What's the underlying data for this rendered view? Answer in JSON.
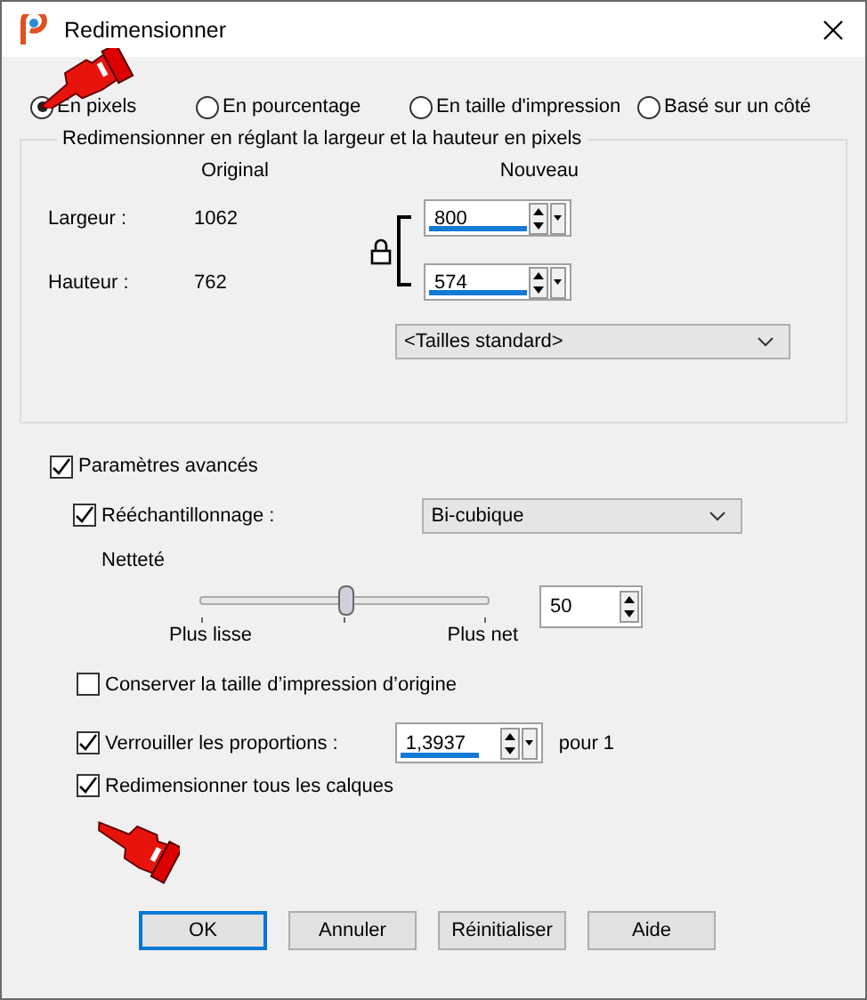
{
  "window": {
    "title": "Redimensionner"
  },
  "modes": [
    {
      "label": "En pixels",
      "selected": true
    },
    {
      "label": "En pourcentage",
      "selected": false
    },
    {
      "label": "En taille d'impression",
      "selected": false
    },
    {
      "label": "Basé sur un côté",
      "selected": false
    }
  ],
  "group": {
    "legend": "Redimensionner en réglant la largeur et la hauteur en pixels",
    "col_original": "Original",
    "col_new": "Nouveau",
    "rows": [
      {
        "label": "Largeur :",
        "original": "1062",
        "value": "800"
      },
      {
        "label": "Hauteur :",
        "original": "762",
        "value": "574"
      }
    ],
    "preset": "<Tailles standard>"
  },
  "advanced": {
    "label": "Paramètres avancés",
    "checked": true
  },
  "resample": {
    "label": "Rééchantillonnage :",
    "checked": true,
    "method": "Bi-cubique"
  },
  "sharpness": {
    "label": "Netteté",
    "level": 0.5,
    "min_label": "Plus lisse",
    "max_label": "Plus net",
    "value": "50"
  },
  "options": [
    {
      "kind": "check",
      "label": "Conserver la taille d’impression d’origine",
      "checked": false
    },
    {
      "kind": "ratio",
      "label": "Verrouiller les proportions :",
      "checked": true,
      "value": "1,3937",
      "suffix": "pour 1"
    },
    {
      "kind": "check",
      "label": "Redimensionner tous les calques",
      "checked": true
    }
  ],
  "buttons": [
    {
      "label": "OK",
      "default": true
    },
    {
      "label": "Annuler",
      "default": false
    },
    {
      "label": "Réinitialiser",
      "default": false
    },
    {
      "label": "Aide",
      "default": false
    }
  ]
}
